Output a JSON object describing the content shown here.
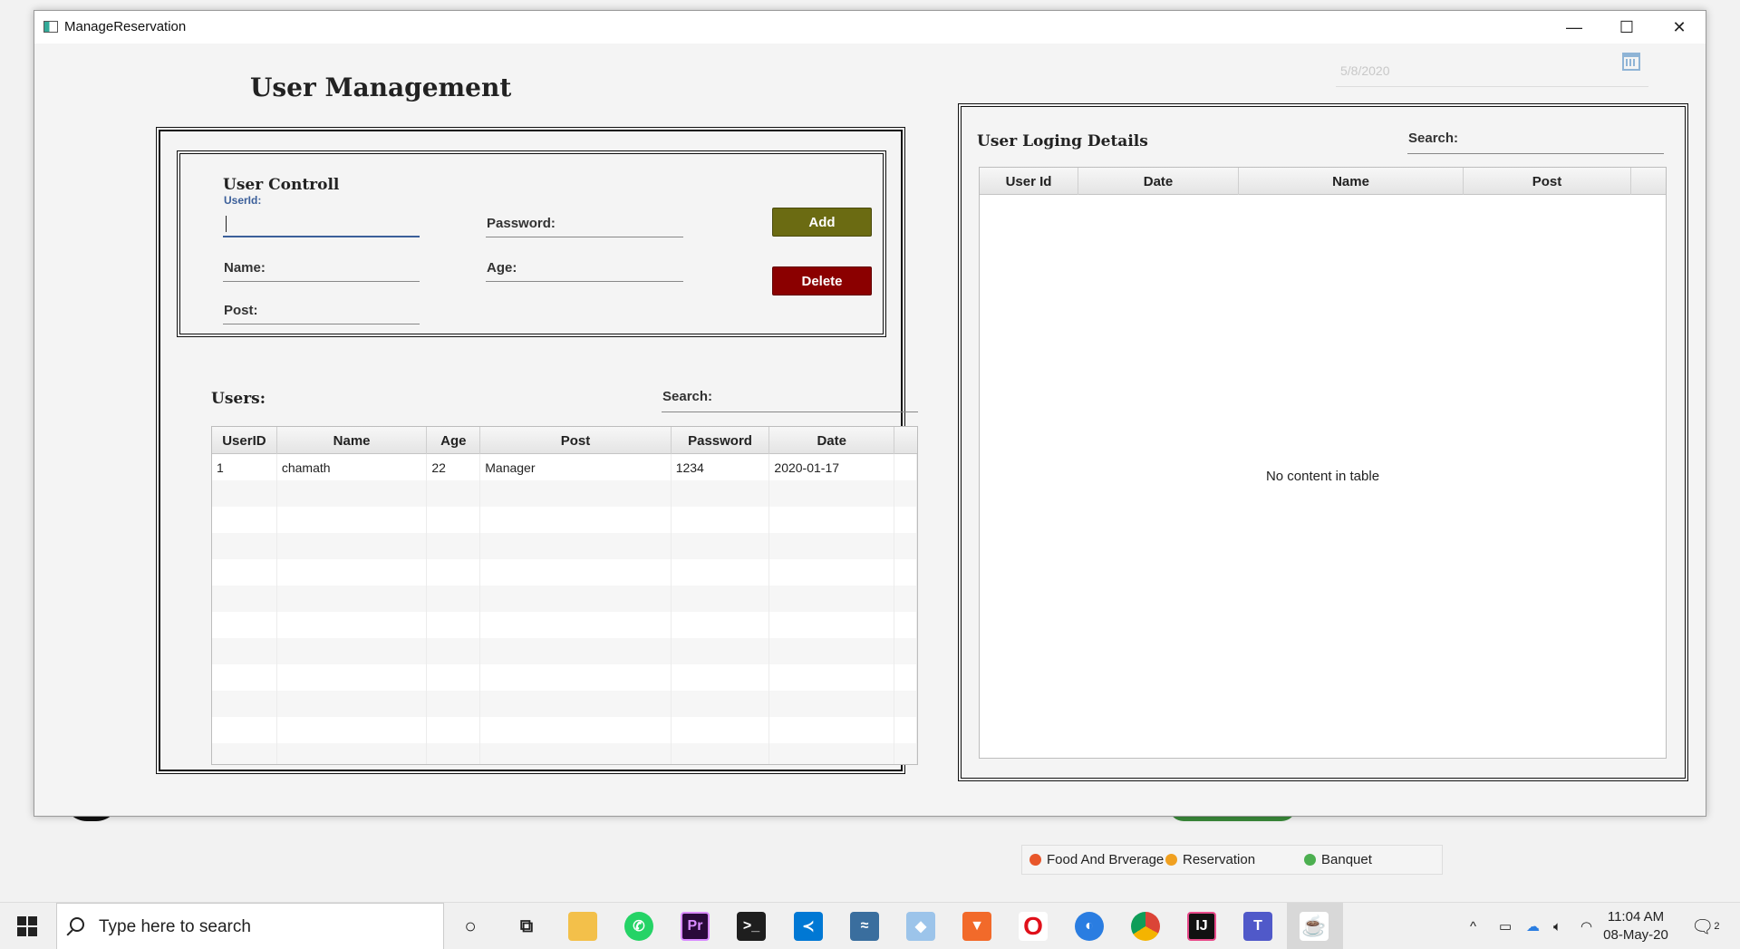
{
  "window": {
    "title": "ManageReservation",
    "minimize": "—",
    "maximize": "☐",
    "close": "✕"
  },
  "date_picker": {
    "value": "5/8/2020"
  },
  "page_title": "User Management",
  "user_control": {
    "title": "User Controll",
    "userid_label": "UserId:",
    "password_label": "Password:",
    "name_label": "Name:",
    "age_label": "Age:",
    "post_label": "Post:",
    "add_label": "Add",
    "delete_label": "Delete"
  },
  "users": {
    "title": "Users:",
    "search_label": "Search:",
    "columns": [
      "UserID",
      "Name",
      "Age",
      "Post",
      "Password",
      "Date"
    ],
    "rows": [
      [
        "1",
        "chamath",
        "22",
        "Manager",
        "1234",
        "2020-01-17"
      ]
    ]
  },
  "login_details": {
    "title": "User  Loging Details",
    "search_label": "Search:",
    "columns": [
      "User Id",
      "Date",
      "Name",
      "Post"
    ],
    "empty_message": "No content in table"
  },
  "legend": {
    "items": [
      {
        "label": "Food And Brverage",
        "color": "#e8562a"
      },
      {
        "label": "Reservation",
        "color": "#f0a020"
      },
      {
        "label": "Banquet",
        "color": "#4caf50"
      }
    ]
  },
  "taskbar": {
    "search_placeholder": "Type here to search",
    "time": "11:04 AM",
    "date": "08-May-20",
    "notification_count": "2",
    "apps": [
      {
        "name": "cortana-icon"
      },
      {
        "name": "task-view-icon"
      },
      {
        "name": "file-explorer-icon"
      },
      {
        "name": "whatsapp-icon"
      },
      {
        "name": "premiere-icon"
      },
      {
        "name": "terminal-icon"
      },
      {
        "name": "vscode-icon"
      },
      {
        "name": "mysql-workbench-icon"
      },
      {
        "name": "cube-icon"
      },
      {
        "name": "brave-icon"
      },
      {
        "name": "opera-icon"
      },
      {
        "name": "firefox-icon"
      },
      {
        "name": "chrome-icon"
      },
      {
        "name": "intellij-icon"
      },
      {
        "name": "teams-icon"
      },
      {
        "name": "java-icon"
      }
    ]
  }
}
